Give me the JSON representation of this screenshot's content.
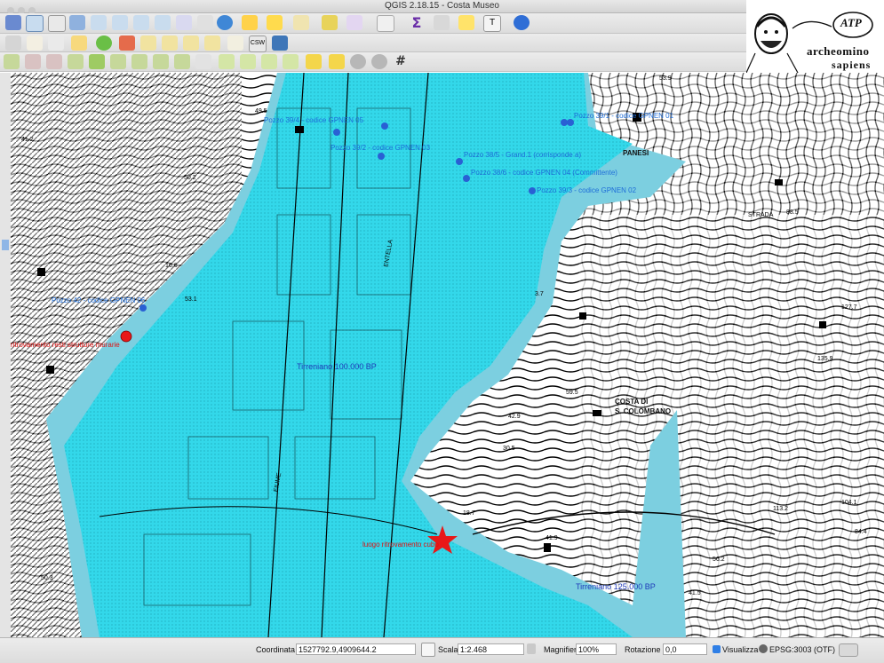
{
  "window": {
    "title": "QGIS 2.18.15 - Costa Museo"
  },
  "logo": {
    "line1": "archeomino",
    "line2": "sapiens",
    "badge": "ATP"
  },
  "toolbar_icons": [
    "zoom-in-icon",
    "pan-icon",
    "zoom-full-icon",
    "zoom-selection-icon",
    "zoom-layer-icon",
    "zoom-last-icon",
    "refresh-icon",
    "identify-icon",
    "select-icon",
    "measure-icon",
    "field-calc-icon",
    "attribute-table-icon",
    "text-annotation-icon",
    "help-icon"
  ],
  "map": {
    "labels_wells": [
      "Pozzo 39/4 - codice GPNEN 05",
      "Pozzo 39/2 - codice GPNEN 03",
      "Pozzo 38/5 - Grand.1 (corrisponde a)",
      "Pozzo 38/6 - codice GPNEN 04 (Committente)",
      "Pozzo 39/3 - codice GPNEN 02",
      "Pozzo 39/1 - codice GPNEN 01",
      "Pozzo 42 - codice GPNEN 06"
    ],
    "label_red_point": "ritrovamento resti strutture murarie",
    "label_star": "luogo ritrovamento cubo",
    "era_100k": "Tirreniano 100.000 BP",
    "era_125k": "Tirreniano 125.000 BP",
    "place_name_1": "COSTA DI",
    "place_name_2": "S. COLOMBANO",
    "place_panesi": "PANESI",
    "place_strada": "STRADA",
    "place_fiume": "FIUME",
    "place_entella": "ENTELLA",
    "elevations": [
      "53.9",
      "88.5",
      "127.7",
      "135.9",
      "59.5",
      "42.9",
      "30.5",
      "104.1",
      "113.2",
      "84.4",
      "56.2",
      "41.5",
      "41.9",
      "18.7",
      "50.2",
      "41.2",
      "50.3",
      "16.6",
      "53.1",
      "3.7",
      "49.5"
    ]
  },
  "statusbar": {
    "coord_label": "Coordinata",
    "coord_value": "1527792.9,4909644.2",
    "scale_label": "Scala",
    "scale_value": "1:2.468",
    "magnifier_label": "Magnifier",
    "magnifier_value": "100%",
    "rotation_label": "Rotazione",
    "rotation_value": "0,0",
    "render_label": "Visualizza",
    "crs_label": "EPSG:3003 (OTF)"
  },
  "colors": {
    "flood": "#33d8ea",
    "well": "#2960d4",
    "find": "#e81818",
    "era_text": "#1e3ab8"
  }
}
